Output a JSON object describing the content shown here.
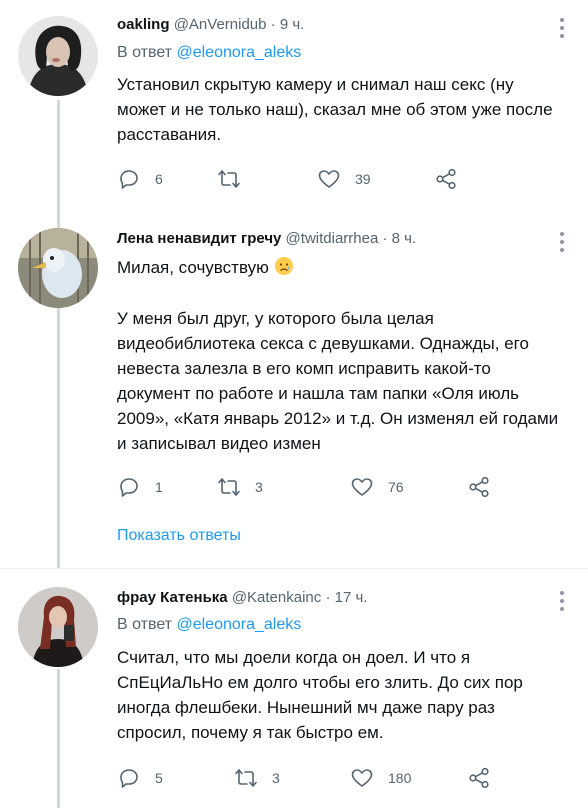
{
  "tweets": [
    {
      "name": "oakling",
      "handle": "@AnVernidub",
      "dot": "·",
      "time": "9 ч.",
      "reply_prefix": "В ответ",
      "reply_mention": "@eleonora_aleks",
      "text": "Установил скрытую камеру и снимал наш секс (ну может и не только наш), сказал мне об этом уже после расставания.",
      "replies": "6",
      "retweets": "",
      "likes": "39"
    },
    {
      "name": "Лена ненавидит гречу",
      "handle": "@twitdiarrhea",
      "dot": "·",
      "time": "8 ч.",
      "text_first": "Милая, сочувствую",
      "emoji": "crying-face-emoji",
      "text_second": "У меня был друг, у которого была целая видеобиблиотека секса с девушками. Однажды, его невеста залезла в его комп исправить какой-то документ по работе и нашла там папки «Оля июль 2009», «Катя январь 2012» и т.д. Он изменял ей годами и записывал видео измен",
      "replies": "1",
      "retweets": "3",
      "likes": "76",
      "show_replies": "Показать ответы"
    },
    {
      "name": "фрау Катенька",
      "handle": "@Katenkainc",
      "dot": "·",
      "time": "17 ч.",
      "reply_prefix": "В ответ",
      "reply_mention": "@eleonora_aleks",
      "text": "Считал, что мы доели когда он доел. И что я СпЕцИаЛьНо ем долго чтобы его злить. До сих пор иногда флешбеки. Нынешний мч даже пару раз спросил, почему я так быстро ем.",
      "replies": "5",
      "retweets": "3",
      "likes": "180"
    }
  ],
  "icons": {
    "reply": "reply-icon",
    "retweet": "retweet-icon",
    "like": "heart-icon",
    "share": "share-icon",
    "more": "more-icon"
  },
  "colors": {
    "accent": "#1d9bf0",
    "secondary_text": "#536471",
    "primary_text": "#0f1419"
  }
}
